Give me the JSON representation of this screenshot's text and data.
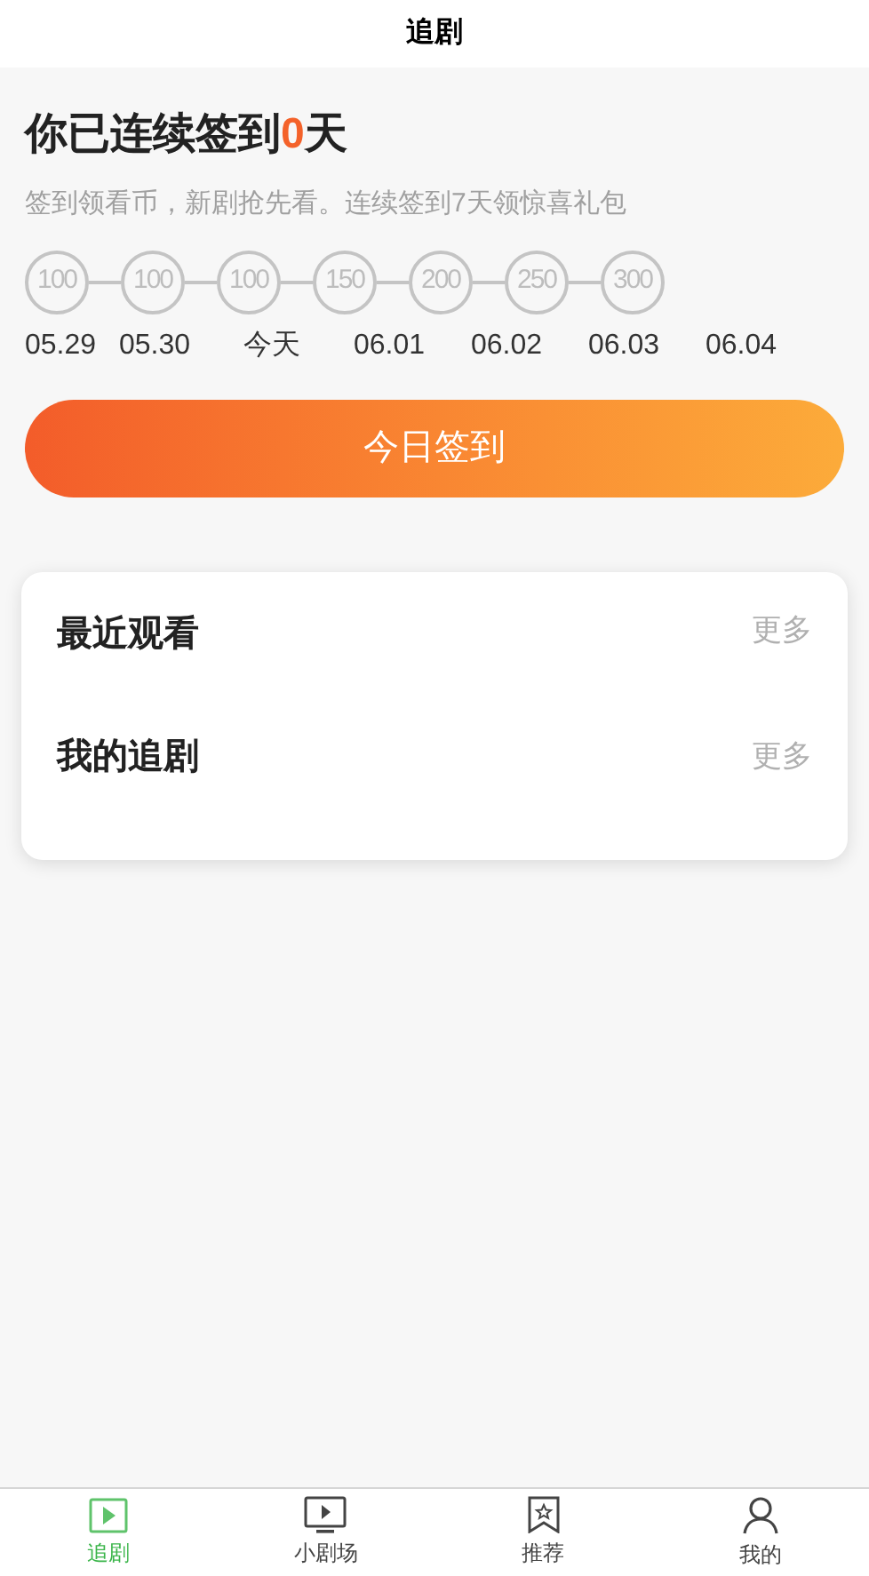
{
  "header": {
    "title": "追剧"
  },
  "checkin": {
    "before": "你已连续签到",
    "count": "0",
    "after": "天",
    "subtitle": "签到领看币，新剧抢先看。连续签到7天领惊喜礼包",
    "days": [
      {
        "coins": "100",
        "date": "05.29"
      },
      {
        "coins": "100",
        "date": "05.30"
      },
      {
        "coins": "100",
        "date": "今天"
      },
      {
        "coins": "150",
        "date": "06.01"
      },
      {
        "coins": "200",
        "date": "06.02"
      },
      {
        "coins": "250",
        "date": "06.03"
      },
      {
        "coins": "300",
        "date": "06.04"
      }
    ],
    "button": "今日签到"
  },
  "sections": [
    {
      "title": "最近观看",
      "more": "更多"
    },
    {
      "title": "我的追剧",
      "more": "更多"
    }
  ],
  "tabs": [
    {
      "kind": "play",
      "label": "追剧",
      "selected": true
    },
    {
      "kind": "tv",
      "label": "小剧场",
      "selected": false
    },
    {
      "kind": "bookmark",
      "label": "推荐",
      "selected": false
    },
    {
      "kind": "user",
      "label": "我的",
      "selected": false
    }
  ]
}
